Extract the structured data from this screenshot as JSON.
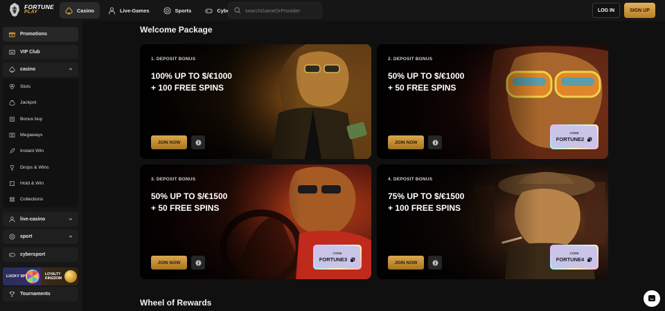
{
  "brand": {
    "name_top": "FORTUNE",
    "name_bottom": "PLAY"
  },
  "nav": {
    "items": [
      {
        "label": "Casino",
        "icon": "spade-icon",
        "active": true
      },
      {
        "label": "Live-Games",
        "icon": "dealer-icon",
        "active": false
      },
      {
        "label": "Sports",
        "icon": "ball-icon",
        "active": false
      },
      {
        "label": "Cybersport",
        "icon": "gamepad-icon",
        "active": false
      }
    ],
    "search_placeholder": "searchGameOrProvider",
    "login_label": "LOG IN",
    "signup_label": "SIGN UP"
  },
  "sidebar": {
    "promotions": "Promotions",
    "vip": "VIP Club",
    "casino": "casino",
    "casino_items": [
      "Slots",
      "Jackpot",
      "Bonus buy",
      "Megaways",
      "Instant Win",
      "Drops & Wins",
      "Hold & Win",
      "Collections"
    ],
    "live_casino": "live-casino",
    "sport": "sport",
    "cybersport": "cybersport",
    "promo_left": "LUCKY SPIN",
    "promo_right_1": "LOYALTY",
    "promo_right_2": "KINGDOM",
    "tournaments": "Tournaments"
  },
  "main": {
    "welcome_title": "Welcome Package",
    "wheel_title": "Wheel of Rewards",
    "join_label": "JOIN NOW",
    "code_caption": "CODE",
    "cards": [
      {
        "label": "1. DEPOSIT BONUS",
        "line1": "100% UP TO $/€1000",
        "line2": "+ 100 FREE SPINS",
        "code": ""
      },
      {
        "label": "2. DEPOSIT BONUS",
        "line1": "50% UP TO $/€1000",
        "line2": "+ 50 FREE SPINS",
        "code": "FORTUNE2"
      },
      {
        "label": "3. DEPOSIT BONUS",
        "line1": "50% UP TO $/€1500",
        "line2": "+ 50 FREE SPINS",
        "code": "FORTUNE3"
      },
      {
        "label": "4. DEPOSIT BONUS",
        "line1": "75% UP TO $/€1500",
        "line2": "+ 100 FREE SPINS",
        "code": "FORTUNE4"
      }
    ]
  },
  "colors": {
    "accent_gold": "#d9a84e",
    "bg": "#101010",
    "panel": "#1f1f1f"
  }
}
